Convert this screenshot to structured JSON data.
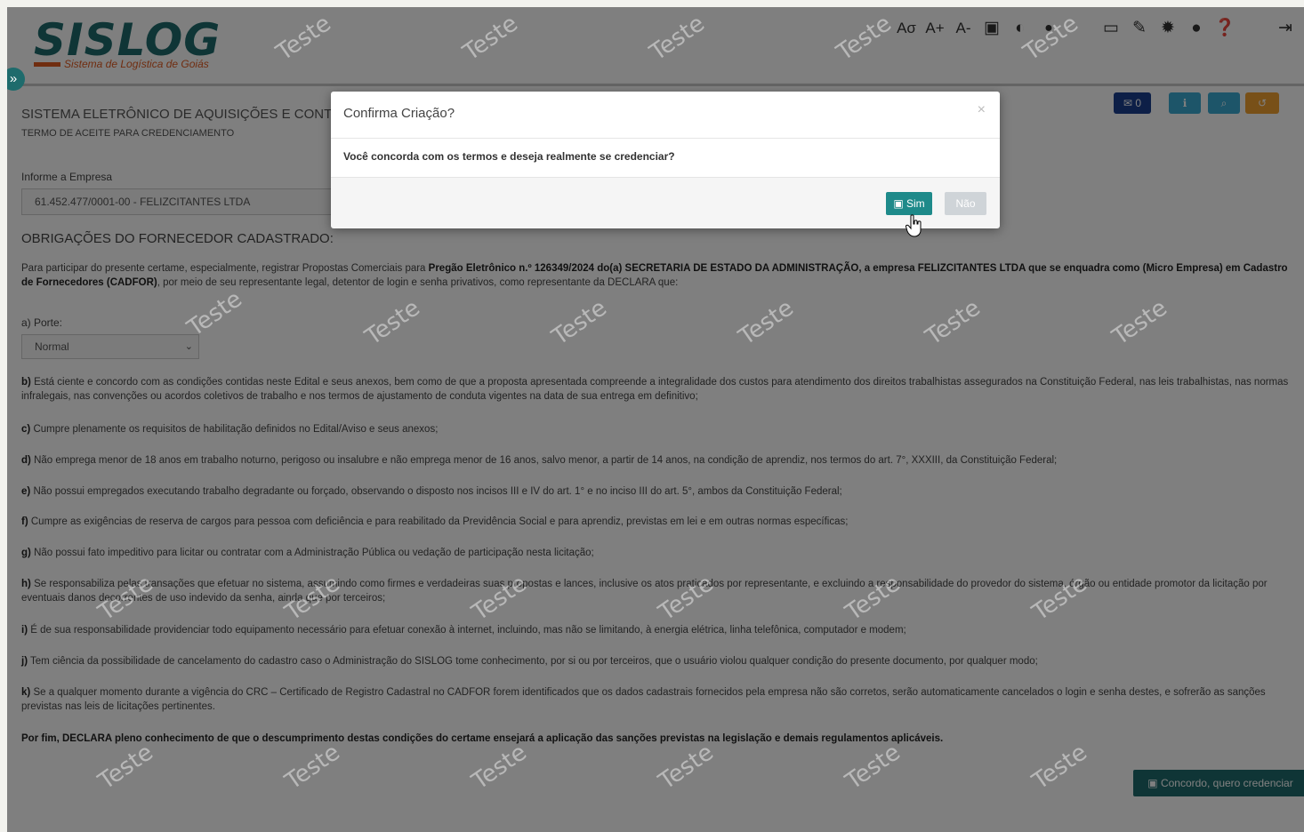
{
  "header": {
    "logo_text": "SISLOG",
    "logo_subtitle": "Sistema de Logística de Goiás",
    "tool_icons": [
      "font-reset-icon",
      "font-increase-icon",
      "font-decrease-icon",
      "cube-icon",
      "contrast-icon",
      "drop-icon",
      "monitor-icon",
      "brush-icon",
      "gear-icon",
      "user-icon",
      "help-icon",
      "logout-icon"
    ],
    "tool_labels": {
      "reset": "Aσ",
      "increase": "A+",
      "decrease": "A-"
    },
    "sidebar_toggle": "»"
  },
  "page": {
    "system_title": "SISTEMA ELETRÔNICO DE AQUISIÇÕES E CONTRA",
    "subtitle": "TERMO DE ACEITE PARA CREDENCIAMENTO",
    "company_label": "Informe a Empresa",
    "company_value": "61.452.477/0001-00 - FELIZCITANTES LTDA",
    "section_title": "OBRIGAÇÕES DO FORNECEDOR CADASTRADO:",
    "intro_pre": "Para participar do presente certame, especialmente, registrar Propostas Comerciais para ",
    "intro_bold": "Pregão Eletrônico n.º 126349/2024 do(a) SECRETARIA DE ESTADO DA ADMINISTRAÇÃO, a empresa FELIZCITANTES LTDA que se enquadra como (Micro Empresa) em Cadastro de Fornecedores (CADFOR)",
    "intro_post": ", por meio de seu representante legal, detentor de login e senha privativos, como representante da DECLARA que:",
    "porte_label": "a) Porte:",
    "porte_value": "Normal",
    "items": [
      {
        "key": "b)",
        "text": "Está ciente e concordo com as condições contidas neste Edital e seus anexos, bem como de que a proposta apresentada compreende a integralidade dos custos para atendimento dos direitos trabalhistas assegurados na Constituição Federal, nas leis trabalhistas, nas normas infralegais, nas convenções ou acordos coletivos de trabalho e nos termos de ajustamento de conduta vigentes na data de sua entrega em definitivo;"
      },
      {
        "key": "c)",
        "text": "Cumpre plenamente os requisitos de habilitação definidos no Edital/Aviso e seus anexos;"
      },
      {
        "key": "d)",
        "text": "Não emprega menor de 18 anos em trabalho noturno, perigoso ou insalubre e não emprega menor de 16 anos, salvo menor, a partir de 14 anos, na condição de aprendiz, nos termos do art. 7°, XXXIII, da Constituição Federal;"
      },
      {
        "key": "e)",
        "text": "Não possui empregados executando trabalho degradante ou forçado, observando o disposto nos incisos III e IV do art. 1° e no inciso III do art. 5°, ambos da Constituição Federal;"
      },
      {
        "key": "f)",
        "text": "Cumpre as exigências de reserva de cargos para pessoa com deficiência e para reabilitado da Previdência Social e para aprendiz, previstas em lei e em outras normas específicas;"
      },
      {
        "key": "g)",
        "text": "Não possui fato impeditivo para licitar ou contratar com a Administração Pública ou vedação de participação nesta licitação;"
      },
      {
        "key": "h)",
        "text": "Se responsabiliza pelas transações que efetuar no sistema, assumindo como firmes e verdadeiras suas propostas e lances, inclusive os atos praticados por representante, e excluindo a responsabilidade do provedor do sistema, órgão ou entidade promotor da licitação por eventuais danos decorrentes de uso indevido da senha, ainda que por terceiros;"
      },
      {
        "key": "i)",
        "text": "É de sua responsabilidade providenciar todo equipamento necessário para efetuar conexão à internet, incluindo, mas não se limitando, à energia elétrica, linha telefônica, computador e modem;"
      },
      {
        "key": "j)",
        "text": "Tem ciência da possibilidade de cancelamento do cadastro caso o Administração do SISLOG tome conhecimento, por si ou por terceiros, que o usuário violou qualquer condição do presente documento, por qualquer modo;"
      },
      {
        "key": "k)",
        "text": "Se a qualquer momento durante a vigência do CRC – Certificado de Registro Cadastral no CADFOR forem identificados que os dados cadastrais fornecidos pela empresa não são corretos, serão automaticamente cancelados o login e senha destes, e sofrerão as sanções previstas nas leis de licitações pertinentes."
      }
    ],
    "closing": "Por fim, DECLARA pleno conhecimento de que o descumprimento destas condições do certame ensejará a aplicação das sanções previstas na legislação e demais regulamentos aplicáveis.",
    "agree_button": "Concordo, quero credenciar",
    "right_buttons": {
      "comments_count": "0"
    },
    "watermark": "Teste"
  },
  "modal": {
    "title": "Confirma Criação?",
    "close": "×",
    "body": "Você concorda com os termos e deseja realmente se credenciar?",
    "yes_label": "Sim",
    "no_label": "Não"
  },
  "colors": {
    "brand": "#1e6b6c",
    "accent": "#e05a20",
    "btn_blue": "#1a3f8f",
    "btn_info": "#3aaad2",
    "btn_warn": "#f0a030"
  }
}
